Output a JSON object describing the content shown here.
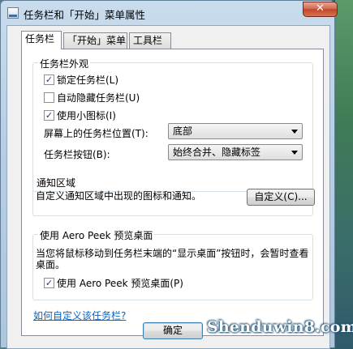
{
  "window": {
    "title": "任务栏和「开始」菜单属性"
  },
  "tabs": [
    {
      "label": "任务栏"
    },
    {
      "label": "「开始」菜单"
    },
    {
      "label": "工具栏"
    }
  ],
  "appearance": {
    "group_title": "任务栏外观",
    "checkboxes": [
      {
        "label": "锁定任务栏(L)",
        "checked": true
      },
      {
        "label": "自动隐藏任务栏(U)",
        "checked": false
      },
      {
        "label": "使用小图标(I)",
        "checked": true
      }
    ],
    "location_label": "屏幕上的任务栏位置(T):",
    "location_value": "底部",
    "buttons_label": "任务栏按钮(B):",
    "buttons_value": "始终合并、隐藏标签"
  },
  "notification": {
    "group_title": "通知区域",
    "description": "自定义通知区域中出现的图标和通知。",
    "customize_button": "自定义(C)..."
  },
  "aero_peek": {
    "group_title": "使用 Aero Peek 预览桌面",
    "description": "当您将鼠标移动到任务栏末端的“显示桌面”按钮时，会暂时查看桌面。",
    "checkbox_label": "使用 Aero Peek 预览桌面(P)",
    "checkbox_checked": true
  },
  "help_link": "如何自定义该任务栏?",
  "footer": {
    "ok_button": "确定"
  },
  "watermark": "Shenduwin8.com"
}
